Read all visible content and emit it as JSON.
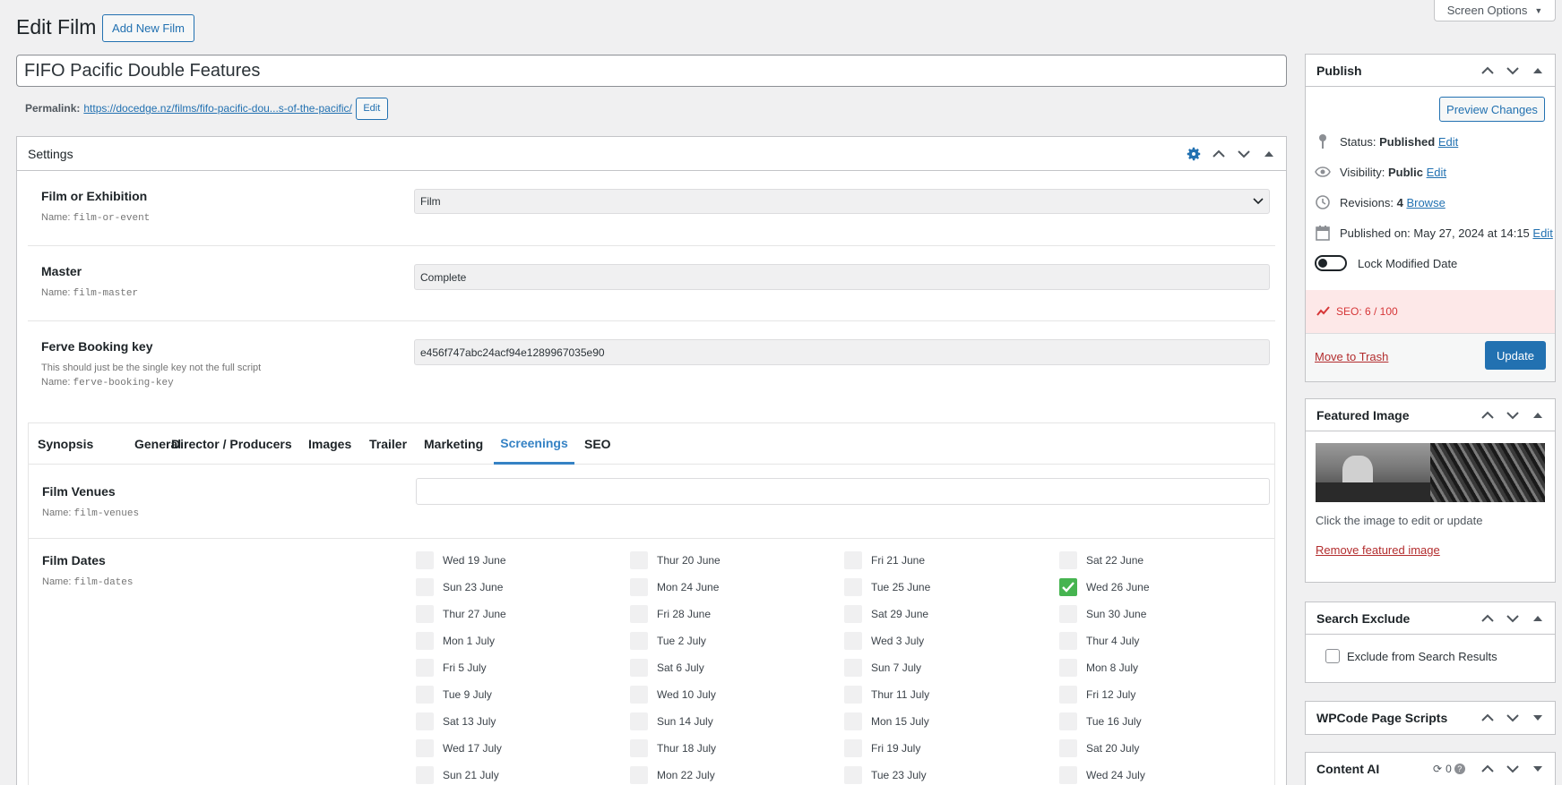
{
  "header": {
    "title": "Edit Film",
    "add_new": "Add New Film",
    "screen_options": "Screen Options"
  },
  "post": {
    "title_value": "FIFO Pacific Double Features",
    "permalink_label": "Permalink:",
    "permalink_url": "https://docedge.nz/films/fifo-pacific-dou...s-of-the-pacific/",
    "permalink_edit": "Edit"
  },
  "settings": {
    "title": "Settings",
    "fields": [
      {
        "label": "Film or Exhibition",
        "desc": "",
        "name_prefix": "Name:",
        "name": "film-or-event",
        "value": "Film"
      },
      {
        "label": "Master",
        "desc": "",
        "name_prefix": "Name:",
        "name": "film-master",
        "value": "Complete"
      },
      {
        "label": "Ferve Booking key",
        "desc": "This should just be the single key not the full script",
        "name_prefix": "Name:",
        "name": "ferve-booking-key",
        "value": "e456f747abc24acf94e1289967035e90"
      }
    ],
    "tabs": [
      "Synopsis",
      "General",
      "Director / Producers",
      "Images",
      "Trailer",
      "Marketing",
      "Screenings",
      "SEO"
    ],
    "active_tab": "Screenings",
    "venues": {
      "label": "Film Venues",
      "name_prefix": "Name:",
      "name": "film-venues",
      "value": ""
    },
    "dates": {
      "label": "Film Dates",
      "name_prefix": "Name:",
      "name": "film-dates",
      "items": [
        {
          "label": "Wed 19 June",
          "checked": false
        },
        {
          "label": "Thur 20 June",
          "checked": false
        },
        {
          "label": "Fri 21 June",
          "checked": false
        },
        {
          "label": "Sat 22 June",
          "checked": false
        },
        {
          "label": "Sun 23 June",
          "checked": false
        },
        {
          "label": "Mon 24 June",
          "checked": false
        },
        {
          "label": "Tue 25 June",
          "checked": false
        },
        {
          "label": "Wed 26 June",
          "checked": true
        },
        {
          "label": "Thur 27 June",
          "checked": false
        },
        {
          "label": "Fri 28 June",
          "checked": false
        },
        {
          "label": "Sat 29 June",
          "checked": false
        },
        {
          "label": "Sun 30 June",
          "checked": false
        },
        {
          "label": "Mon 1 July",
          "checked": false
        },
        {
          "label": "Tue 2 July",
          "checked": false
        },
        {
          "label": "Wed 3 July",
          "checked": false
        },
        {
          "label": "Thur 4 July",
          "checked": false
        },
        {
          "label": "Fri 5 July",
          "checked": false
        },
        {
          "label": "Sat 6 July",
          "checked": false
        },
        {
          "label": "Sun 7 July",
          "checked": false
        },
        {
          "label": "Mon 8 July",
          "checked": false
        },
        {
          "label": "Tue 9 July",
          "checked": false
        },
        {
          "label": "Wed 10 July",
          "checked": false
        },
        {
          "label": "Thur 11 July",
          "checked": false
        },
        {
          "label": "Fri 12 July",
          "checked": false
        },
        {
          "label": "Sat 13 July",
          "checked": false
        },
        {
          "label": "Sun 14 July",
          "checked": false
        },
        {
          "label": "Mon 15 July",
          "checked": false
        },
        {
          "label": "Tue 16 July",
          "checked": false
        },
        {
          "label": "Wed 17 July",
          "checked": false
        },
        {
          "label": "Thur 18 July",
          "checked": false
        },
        {
          "label": "Fri 19 July",
          "checked": false
        },
        {
          "label": "Sat 20 July",
          "checked": false
        },
        {
          "label": "Sun 21 July",
          "checked": false
        },
        {
          "label": "Mon 22 July",
          "checked": false
        },
        {
          "label": "Tue 23 July",
          "checked": false
        },
        {
          "label": "Wed 24 July",
          "checked": false
        }
      ]
    }
  },
  "publish": {
    "title": "Publish",
    "preview": "Preview Changes",
    "status_label": "Status:",
    "status_value": "Published",
    "visibility_label": "Visibility:",
    "visibility_value": "Public",
    "revisions_label": "Revisions:",
    "revisions_value": "4",
    "browse": "Browse",
    "published_label": "Published on:",
    "published_value": "May 27, 2024 at 14:15",
    "edit": "Edit",
    "lock_label": "Lock Modified Date",
    "seo_label": "SEO: 6 / 100",
    "trash": "Move to Trash",
    "update": "Update"
  },
  "featured_image": {
    "title": "Featured Image",
    "hint": "Click the image to edit or update",
    "remove": "Remove featured image"
  },
  "search_exclude": {
    "title": "Search Exclude",
    "label": "Exclude from Search Results"
  },
  "wpcode": {
    "title": "WPCode Page Scripts"
  },
  "content_ai": {
    "title": "Content AI",
    "count": "0"
  },
  "colors": {
    "accent": "#2271b1",
    "active_tab": "#3582c4",
    "checked": "#46b450",
    "seo_bg": "#fde8e8",
    "seo_text": "#d63638",
    "trash": "#b32d2e"
  }
}
